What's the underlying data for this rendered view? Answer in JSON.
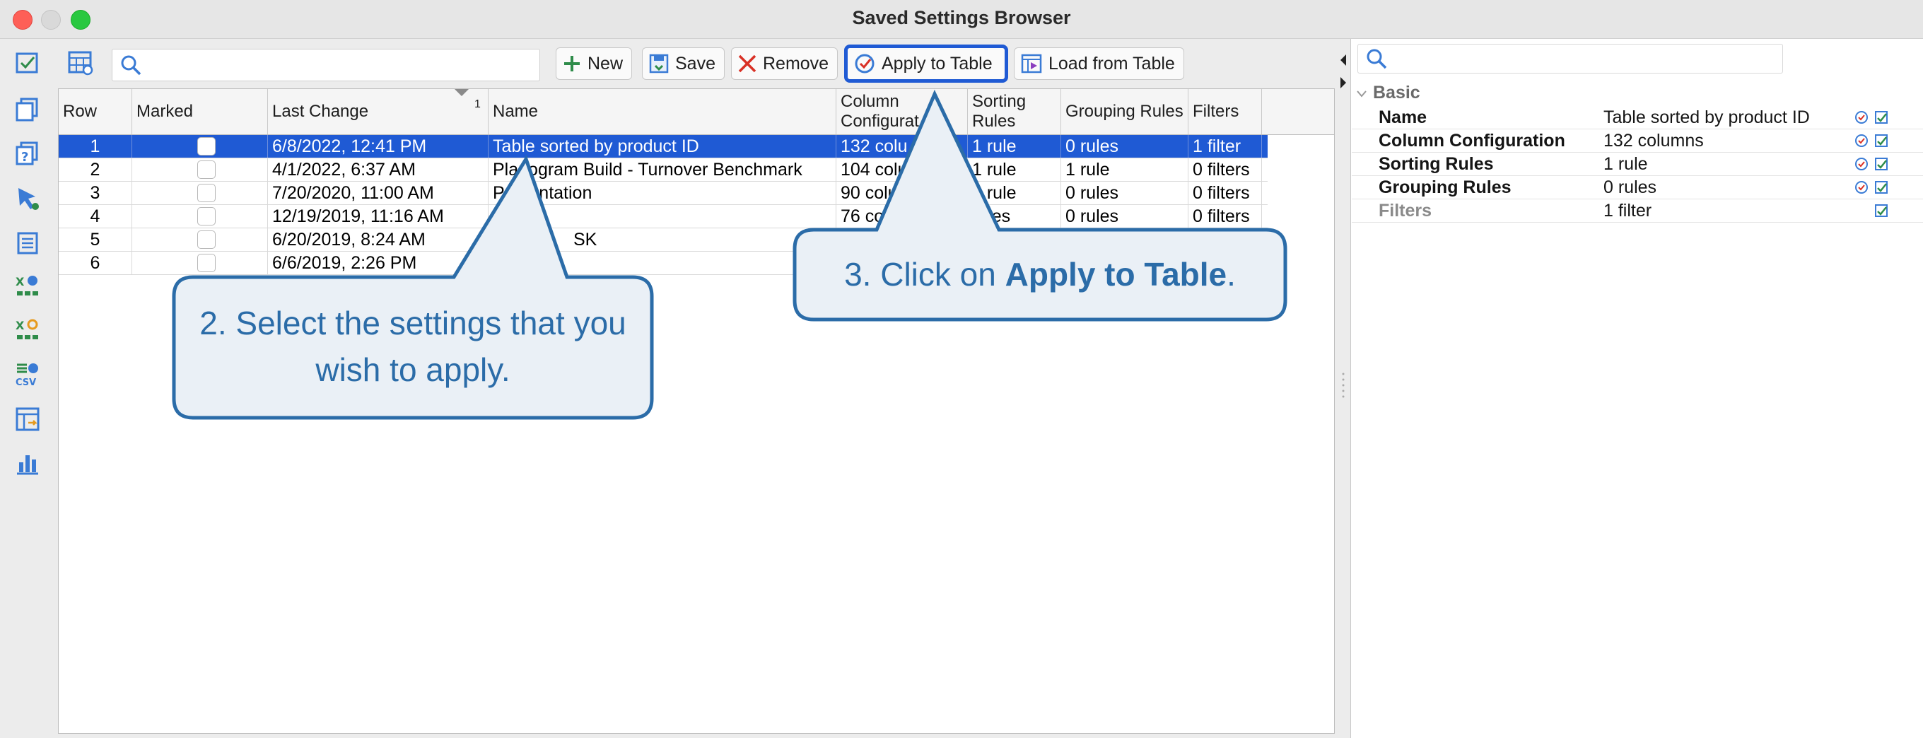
{
  "window": {
    "title": "Saved Settings Browser"
  },
  "toolbar": {
    "new_label": "New",
    "save_label": "Save",
    "remove_label": "Remove",
    "apply_label": "Apply to Table",
    "load_label": "Load from Table",
    "search_placeholder": ""
  },
  "table": {
    "columns": {
      "row": "Row",
      "marked": "Marked",
      "last_change": "Last Change",
      "last_change_sort": "1",
      "name": "Name",
      "column_config_1": "Column",
      "column_config_2": "Configurat",
      "sorting_1": "Sorting",
      "sorting_2": "Rules",
      "grouping": "Grouping Rules",
      "filters": "Filters"
    },
    "rows": [
      {
        "row": "1",
        "last_change": "6/8/2022, 12:41 PM",
        "name": "Table sorted by product ID",
        "column_config": "132 colu",
        "sorting": "1 rule",
        "grouping": "0 rules",
        "filters": "1 filter"
      },
      {
        "row": "2",
        "last_change": "4/1/2022, 6:37 AM",
        "name": "Planogram Build - Turnover Benchmark",
        "column_config": "104 colu",
        "sorting": "1 rule",
        "grouping": "1 rule",
        "filters": "0 filters"
      },
      {
        "row": "3",
        "last_change": "7/20/2020, 11:00 AM",
        "name": "Presentation",
        "column_config": "90 colu",
        "sorting": "1 rule",
        "grouping": "0 rules",
        "filters": "0 filters"
      },
      {
        "row": "4",
        "last_change": "12/19/2019, 11:16 AM",
        "name": "",
        "column_config": "76 co",
        "sorting": "rules",
        "grouping": "0 rules",
        "filters": "0 filters"
      },
      {
        "row": "5",
        "last_change": "6/20/2019, 8:24 AM",
        "name": "SK",
        "column_config": "",
        "sorting": "",
        "grouping": "",
        "filters": ""
      },
      {
        "row": "6",
        "last_change": "6/6/2019, 2:26 PM",
        "name": "",
        "column_config": "",
        "sorting": "",
        "grouping": "",
        "filters": ""
      }
    ]
  },
  "properties": {
    "search_placeholder": "",
    "section": "Basic",
    "rows": [
      {
        "key": "Name",
        "value": "Table sorted by product ID"
      },
      {
        "key": "Column Configuration",
        "value": "132 columns"
      },
      {
        "key": "Sorting Rules",
        "value": "1 rule"
      },
      {
        "key": "Grouping Rules",
        "value": "0 rules"
      },
      {
        "key": "Filters",
        "value": "1 filter"
      }
    ]
  },
  "callouts": {
    "step2": "2. Select the settings that you wish to apply.",
    "step3_prefix": "3. Click on ",
    "step3_bold": "Apply to Table",
    "step3_suffix": "."
  },
  "colors": {
    "selection": "#1f5ad4",
    "callout_border": "#2b6ca8",
    "callout_fill": "#eaf0f6",
    "highlight": "#1f5ad4"
  }
}
